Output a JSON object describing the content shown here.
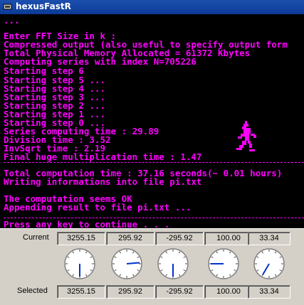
{
  "window": {
    "title": "hexusFastR"
  },
  "console": {
    "lines": [
      "...",
      "Enter FFT Size in k :",
      "Compressed output (also useful to specify output form",
      "Total Physical Memory Allocated = 61372 Kbytes",
      "Computing series with index N=705226",
      "Starting step 6",
      "Starting step 5 ...",
      "Starting step 4 ...",
      "Starting step 3 ...",
      "Starting step 2 ...",
      "Starting step 1 ...",
      "Starting step 0 ...",
      "Series computing time : 29.89",
      "Division time : 3.52",
      "InvSqrt time : 2.19",
      "Final huge multiplication time : 1.47",
      "Total computation time : 37.16 seconds(~ 0.01 hours)",
      "Writing informations into file pi.txt",
      "",
      "The computation seems OK",
      "Appending result to file pi.txt ...",
      "",
      "Press any key to continue . . ."
    ],
    "text_color": "#ff00ff"
  },
  "panel": {
    "current_label": "Current",
    "selected_label": "Selected",
    "current_values": [
      "3255.15",
      "295.92",
      "-295.92",
      "100.00",
      "33.34"
    ],
    "selected_values": [
      "3255.15",
      "295.92",
      "-295.92",
      "100.00",
      "33.34"
    ],
    "gauges": [
      {
        "icon": "clock-gauge-icon",
        "angle_deg": 180
      },
      {
        "icon": "clock-gauge-icon",
        "angle_deg": 85
      },
      {
        "icon": "clock-gauge-icon",
        "angle_deg": 180
      },
      {
        "icon": "clock-gauge-icon",
        "angle_deg": 270
      },
      {
        "icon": "clock-gauge-icon",
        "angle_deg": 210
      }
    ]
  }
}
